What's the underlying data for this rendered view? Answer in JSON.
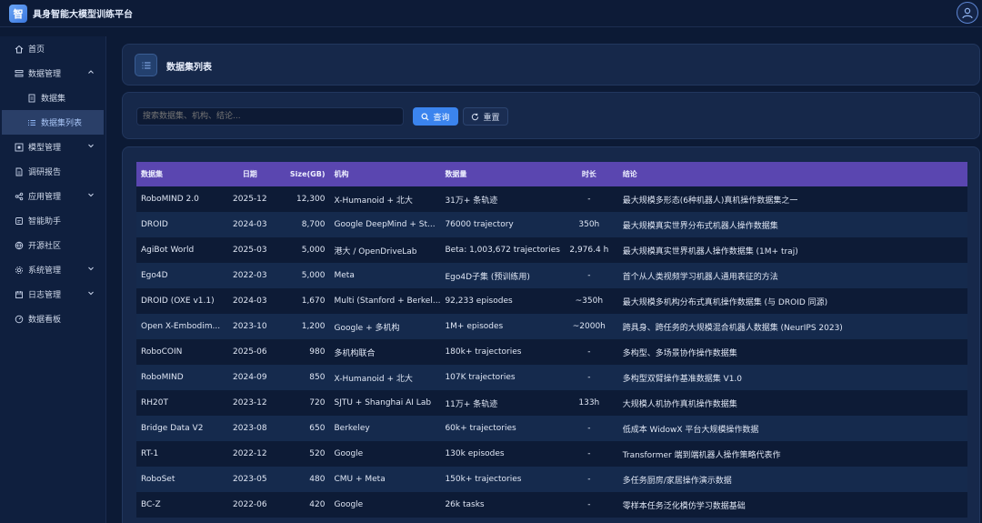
{
  "app": {
    "logo_char": "智",
    "title": "具身智能大模型训练平台"
  },
  "sidebar": {
    "items": [
      {
        "label": "首页"
      },
      {
        "label": "数据管理"
      },
      {
        "label": "数据集"
      },
      {
        "label": "数据集列表"
      },
      {
        "label": "模型管理"
      },
      {
        "label": "调研报告"
      },
      {
        "label": "应用管理"
      },
      {
        "label": "智能助手"
      },
      {
        "label": "开源社区"
      },
      {
        "label": "系统管理"
      },
      {
        "label": "日志管理"
      },
      {
        "label": "数据看板"
      }
    ]
  },
  "page": {
    "title": "数据集列表"
  },
  "search": {
    "placeholder": "搜索数据集、机构、结论...",
    "query_label": "查询",
    "reset_label": "重置"
  },
  "table": {
    "headers": [
      "数据集",
      "日期",
      "Size(GB)",
      "机构",
      "数据量",
      "时长",
      "结论"
    ],
    "rows": [
      [
        "RoboMIND 2.0",
        "2025-12",
        "12,300",
        "X-Humanoid + 北大",
        "31万+ 条轨迹",
        "-",
        "最大规模多形态(6种机器人)真机操作数据集之一"
      ],
      [
        "DROID",
        "2024-03",
        "8,700",
        "Google DeepMind + St...",
        "76000 trajectory",
        "350h",
        "最大规模真实世界分布式机器人操作数据集"
      ],
      [
        "AgiBot World",
        "2025-03",
        "5,000",
        "港大 / OpenDriveLab",
        "Beta: 1,003,672 trajectories",
        "2,976.4 h",
        "最大规模真实世界机器人操作数据集 (1M+ traj)"
      ],
      [
        "Ego4D",
        "2022-03",
        "5,000",
        "Meta",
        "Ego4D子集 (预训练用)",
        "-",
        "首个从人类视频学习机器人通用表征的方法"
      ],
      [
        "DROID (OXE v1.1)",
        "2024-03",
        "1,670",
        "Multi (Stanford + Berkel...",
        "92,233 episodes",
        "~350h",
        "最大规模多机构分布式真机操作数据集 (与 DROID 同源)"
      ],
      [
        "Open X-Embodim...",
        "2023-10",
        "1,200",
        "Google + 多机构",
        "1M+ episodes",
        "~2000h",
        "跨具身、跨任务的大规模混合机器人数据集 (NeurIPS 2023)"
      ],
      [
        "RoboCOIN",
        "2025-06",
        "980",
        "多机构联合",
        "180k+ trajectories",
        "-",
        "多构型、多场景协作操作数据集"
      ],
      [
        "RoboMIND",
        "2024-09",
        "850",
        "X-Humanoid + 北大",
        "107K trajectories",
        "-",
        "多构型双臂操作基准数据集 V1.0"
      ],
      [
        "RH20T",
        "2023-12",
        "720",
        "SJTU + Shanghai AI Lab",
        "11万+ 条轨迹",
        "133h",
        "大规模人机协作真机操作数据集"
      ],
      [
        "Bridge Data V2",
        "2023-08",
        "650",
        "Berkeley",
        "60k+ trajectories",
        "-",
        "低成本 WidowX 平台大规模操作数据"
      ],
      [
        "RT-1",
        "2022-12",
        "520",
        "Google",
        "130k episodes",
        "-",
        "Transformer 端到端机器人操作策略代表作"
      ],
      [
        "RoboSet",
        "2023-05",
        "480",
        "CMU + Meta",
        "150k+ trajectories",
        "-",
        "多任务厨房/家居操作演示数据"
      ],
      [
        "BC-Z",
        "2022-06",
        "420",
        "Google",
        "26k tasks",
        "-",
        "零样本任务泛化模仿学习数据基础"
      ]
    ]
  },
  "colors": {
    "accent": "#3b84ee",
    "header_row": "#5a46b0",
    "background": "#0c1a35"
  }
}
